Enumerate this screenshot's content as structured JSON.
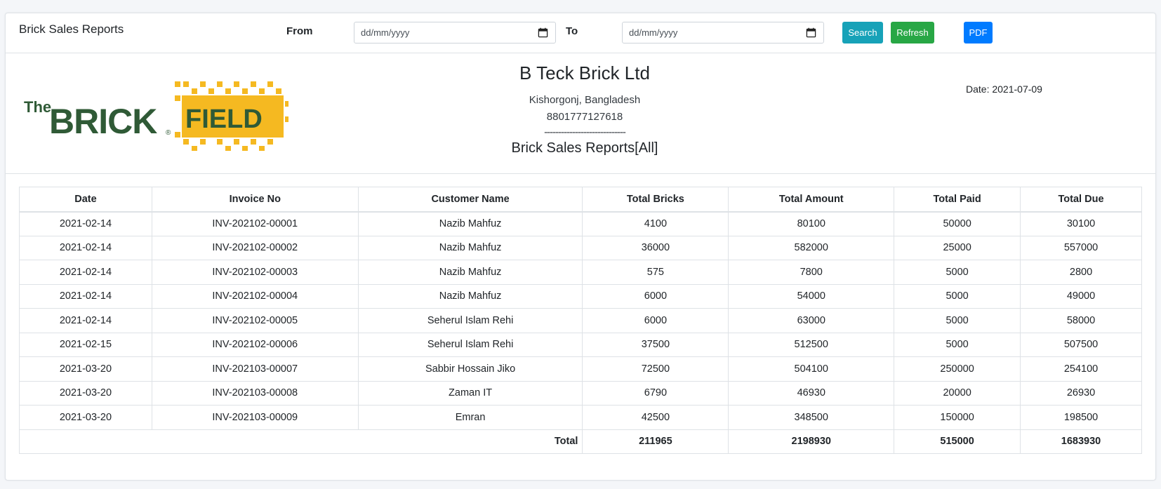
{
  "header": {
    "title": "Brick Sales Reports",
    "from_label": "From",
    "to_label": "To",
    "from_placeholder": "dd/mm/yyyy",
    "to_placeholder": "dd/mm/yyyy",
    "search_label": "Search",
    "refresh_label": "Refresh",
    "pdf_label": "PDF"
  },
  "colors": {
    "search": "#17a2b8",
    "refresh": "#28a745",
    "pdf": "#007bff",
    "logo_green": "#2f5a36",
    "logo_yellow": "#f5b921"
  },
  "logo": {
    "the": "The",
    "brick": "BRICK",
    "field": "FIELD",
    "reg": "®"
  },
  "company": {
    "name": "B Teck Brick Ltd",
    "address": "Kishorgonj, Bangladesh",
    "phone": "8801777127618",
    "divider": "-----------------------------",
    "report_title": "Brick Sales Reports[All]",
    "date": "Date: 2021-07-09"
  },
  "table": {
    "columns": [
      "Date",
      "Invoice No",
      "Customer Name",
      "Total Bricks",
      "Total Amount",
      "Total Paid",
      "Total Due"
    ],
    "rows": [
      [
        "2021-02-14",
        "INV-202102-00001",
        "Nazib Mahfuz",
        "4100",
        "80100",
        "50000",
        "30100"
      ],
      [
        "2021-02-14",
        "INV-202102-00002",
        "Nazib Mahfuz",
        "36000",
        "582000",
        "25000",
        "557000"
      ],
      [
        "2021-02-14",
        "INV-202102-00003",
        "Nazib Mahfuz",
        "575",
        "7800",
        "5000",
        "2800"
      ],
      [
        "2021-02-14",
        "INV-202102-00004",
        "Nazib Mahfuz",
        "6000",
        "54000",
        "5000",
        "49000"
      ],
      [
        "2021-02-14",
        "INV-202102-00005",
        "Seherul Islam Rehi",
        "6000",
        "63000",
        "5000",
        "58000"
      ],
      [
        "2021-02-15",
        "INV-202102-00006",
        "Seherul Islam Rehi",
        "37500",
        "512500",
        "5000",
        "507500"
      ],
      [
        "2021-03-20",
        "INV-202103-00007",
        "Sabbir Hossain Jiko",
        "72500",
        "504100",
        "250000",
        "254100"
      ],
      [
        "2021-03-20",
        "INV-202103-00008",
        "Zaman IT",
        "6790",
        "46930",
        "20000",
        "26930"
      ],
      [
        "2021-03-20",
        "INV-202103-00009",
        "Emran",
        "42500",
        "348500",
        "150000",
        "198500"
      ]
    ],
    "total_label": "Total",
    "totals": [
      "211965",
      "2198930",
      "515000",
      "1683930"
    ]
  }
}
